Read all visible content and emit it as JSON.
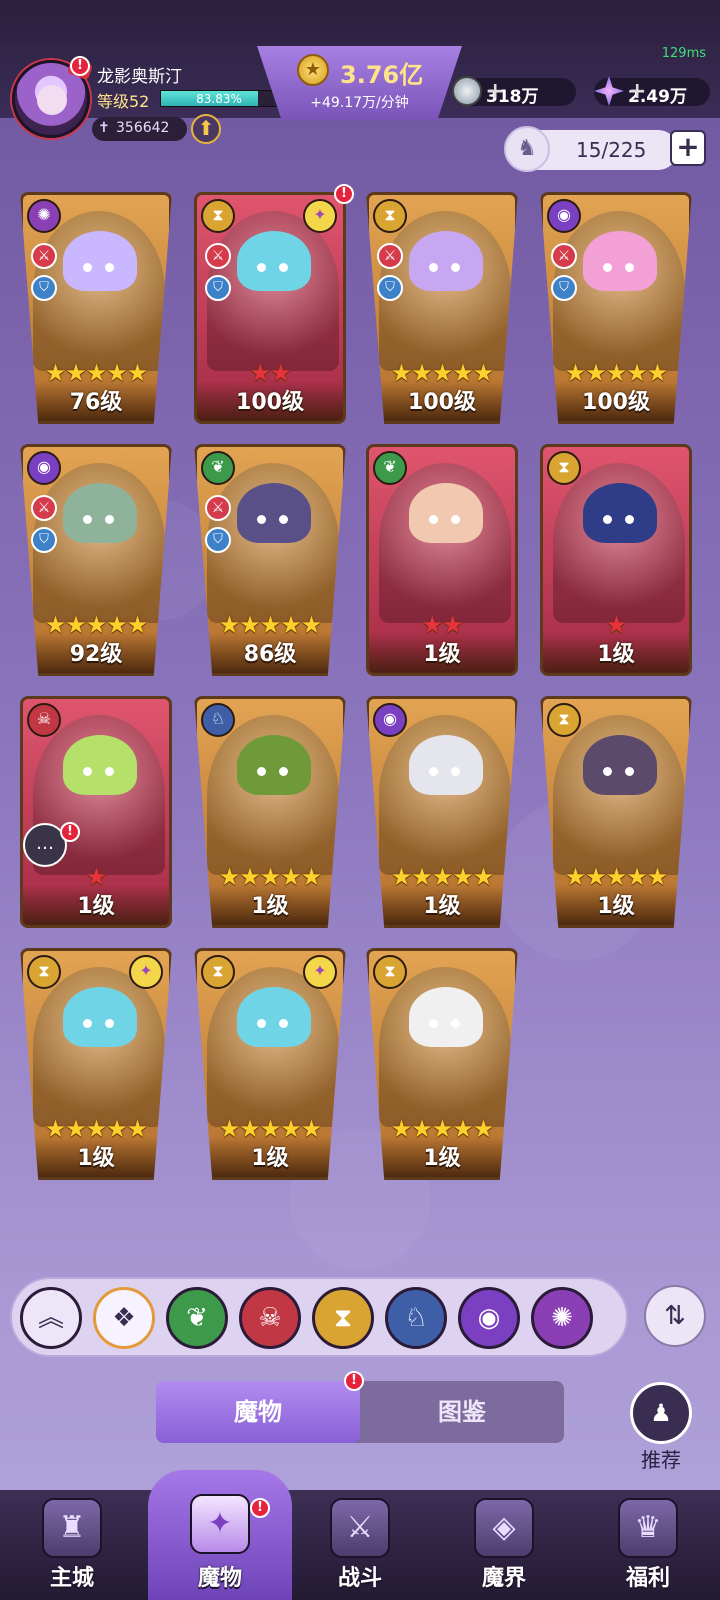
{
  "status": {
    "ping": "129ms"
  },
  "player": {
    "name": "龙影奥斯汀",
    "level_label": "等级52",
    "exp_percent": 83.83,
    "exp_text": "83.83%",
    "power": "356642"
  },
  "currency": {
    "gold_amount": "3.76亿",
    "gold_rate": "+49.17万/分钟"
  },
  "resources": [
    {
      "icon": "silver-token-icon",
      "value": "318万"
    },
    {
      "icon": "crystal-star-icon",
      "value": "2.49万"
    }
  ],
  "slots": {
    "text": "15/225"
  },
  "cards": [
    {
      "level": "76级",
      "stars": 5,
      "star_color": "gold",
      "frame": "gold",
      "element_icon": "purple-swirl-icon",
      "alert": false
    },
    {
      "level": "100级",
      "stars": 2,
      "star_color": "red",
      "frame": "red",
      "element_icon": "hourglass-icon",
      "alert": true
    },
    {
      "level": "100级",
      "stars": 5,
      "star_color": "gold",
      "frame": "gold",
      "element_icon": "hourglass-icon",
      "alert": false
    },
    {
      "level": "100级",
      "stars": 5,
      "star_color": "gold",
      "frame": "gold",
      "element_icon": "eye-icon",
      "alert": false
    },
    {
      "level": "92级",
      "stars": 5,
      "star_color": "gold",
      "frame": "gold",
      "element_icon": "eye-icon",
      "alert": false
    },
    {
      "level": "86级",
      "stars": 5,
      "star_color": "gold",
      "frame": "gold",
      "element_icon": "leaf-icon",
      "alert": false
    },
    {
      "level": "1级",
      "stars": 2,
      "star_color": "red",
      "frame": "red",
      "element_icon": "leaf-icon",
      "alert": false
    },
    {
      "level": "1级",
      "stars": 1,
      "star_color": "red",
      "frame": "red",
      "element_icon": "hourglass-icon",
      "alert": false
    },
    {
      "level": "1级",
      "stars": 1,
      "star_color": "red",
      "frame": "red",
      "element_icon": "demon-mask-icon",
      "alert": true
    },
    {
      "level": "1级",
      "stars": 5,
      "star_color": "gold",
      "frame": "gold",
      "element_icon": "dragon-icon",
      "alert": false
    },
    {
      "level": "1级",
      "stars": 5,
      "star_color": "gold",
      "frame": "gold",
      "element_icon": "eye-icon",
      "alert": false
    },
    {
      "level": "1级",
      "stars": 5,
      "star_color": "gold",
      "frame": "gold",
      "element_icon": "hourglass-icon",
      "alert": false
    },
    {
      "level": "1级",
      "stars": 5,
      "star_color": "gold",
      "frame": "gold",
      "element_icon": "hourglass-icon",
      "alert": false
    },
    {
      "level": "1级",
      "stars": 5,
      "star_color": "gold",
      "frame": "gold",
      "element_icon": "hourglass-icon",
      "alert": false
    },
    {
      "level": "1级",
      "stars": 5,
      "star_color": "gold",
      "frame": "gold",
      "element_icon": "hourglass-icon",
      "alert": false
    }
  ],
  "filters": [
    {
      "icon": "collapse-up-icon",
      "color": "#ece6f8"
    },
    {
      "icon": "all-diamond-icon",
      "color": "#f7f2ff"
    },
    {
      "icon": "leaf-icon",
      "color": "#3d9a4a"
    },
    {
      "icon": "demon-mask-icon",
      "color": "#c23744"
    },
    {
      "icon": "hourglass-icon",
      "color": "#d9a431"
    },
    {
      "icon": "dragon-icon",
      "color": "#3e5fa8"
    },
    {
      "icon": "eye-icon",
      "color": "#7b3fc2"
    },
    {
      "icon": "purple-swirl-icon",
      "color": "#8b3fb4"
    }
  ],
  "tabs": {
    "monsters": "魔物",
    "codex": "图鉴"
  },
  "recommend_label": "推荐",
  "nav": [
    "主城",
    "魔物",
    "战斗",
    "魔界",
    "福利"
  ],
  "colors": {
    "accent": "#8a5fd6",
    "gold_text": "#ffe38a",
    "exp_fill": "#2fb3b4",
    "alert_red": "#e6233c"
  }
}
